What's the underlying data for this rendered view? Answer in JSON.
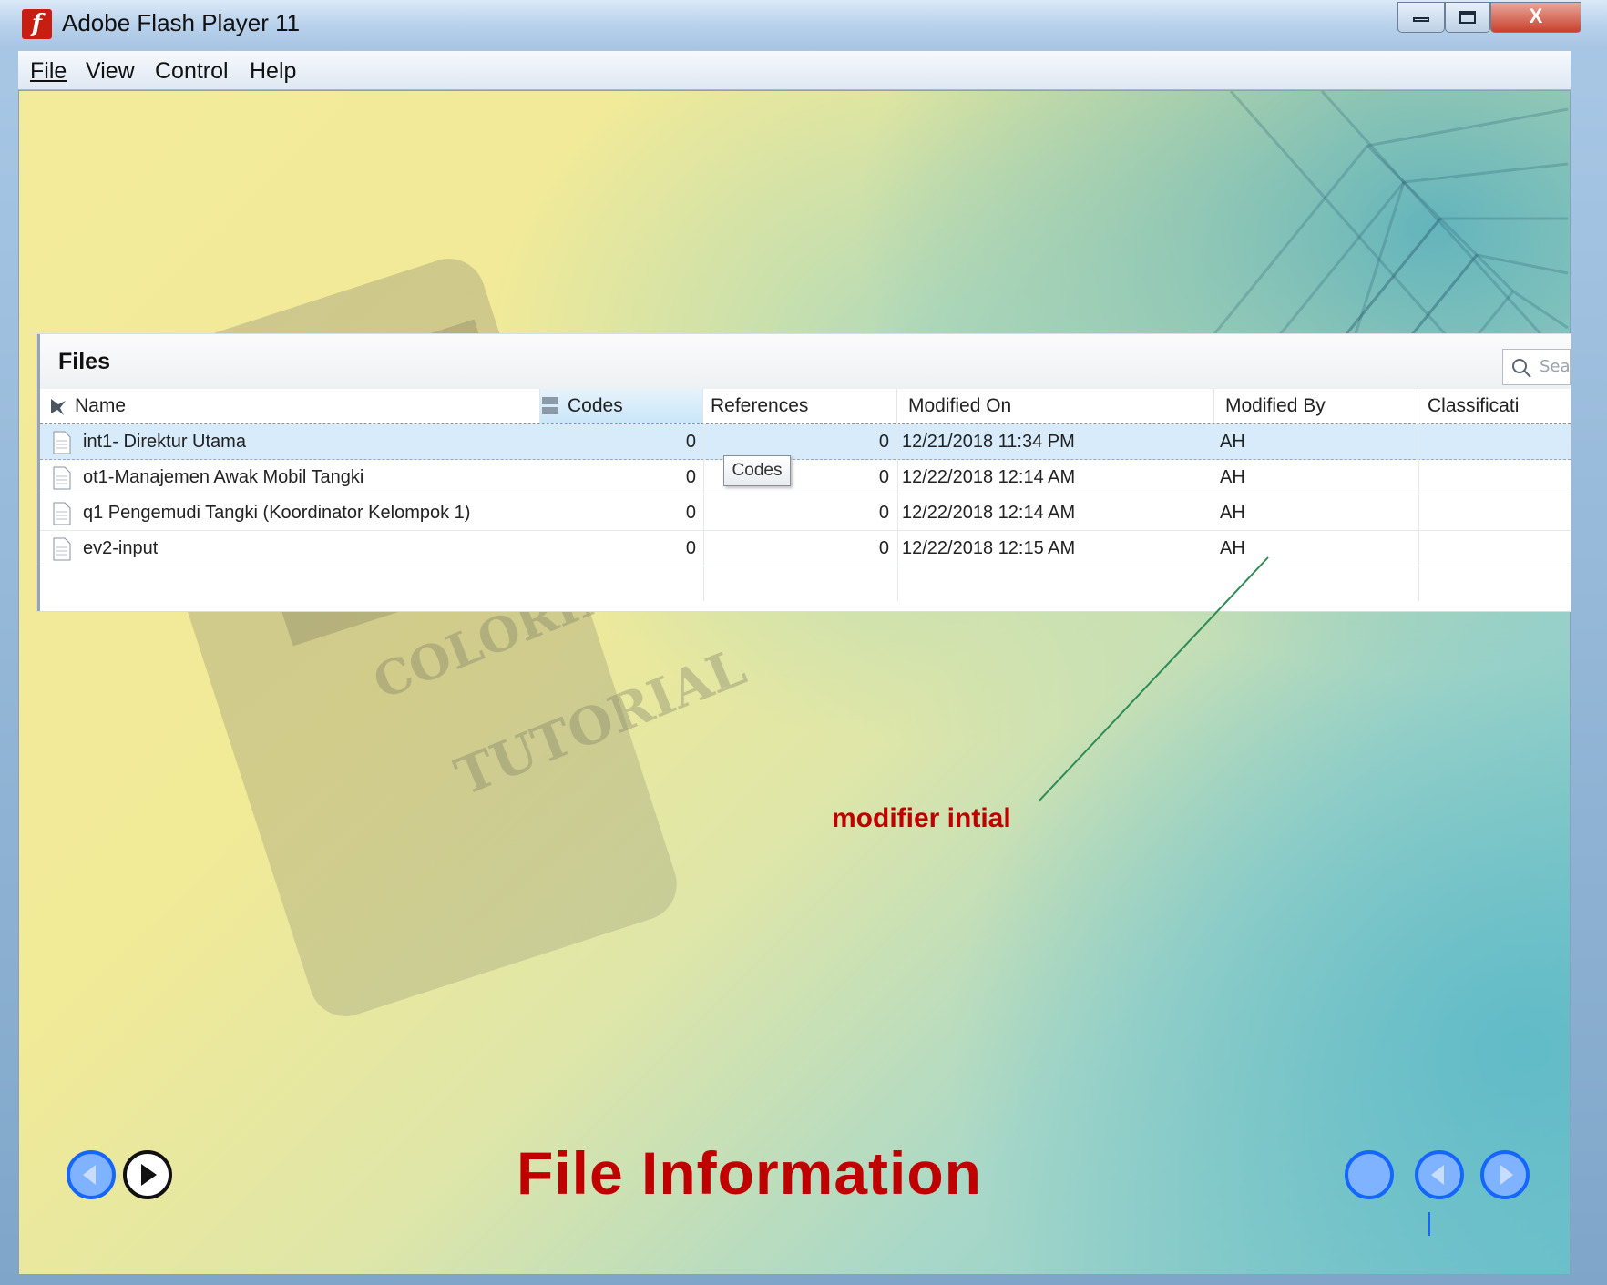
{
  "window": {
    "title": "Adobe Flash Player 11",
    "close_glyph": "X"
  },
  "menu": {
    "items": [
      "File",
      "View",
      "Control",
      "Help"
    ]
  },
  "panel": {
    "title": "Files",
    "search_placeholder": "Sea",
    "columns": [
      "Name",
      "Codes",
      "References",
      "Modified On",
      "Modified By",
      "Classificati"
    ],
    "rows": [
      {
        "name": "int1- Direktur Utama",
        "codes": "0",
        "references": "0",
        "modified_on": "12/21/2018 11:34 PM",
        "modified_by": "AH",
        "classification": ""
      },
      {
        "name": "ot1-Manajemen Awak Mobil Tangki",
        "codes": "0",
        "references": "0",
        "modified_on": "12/22/2018 12:14 AM",
        "modified_by": "AH",
        "classification": ""
      },
      {
        "name": "q1 Pengemudi Tangki (Koordinator Kelompok 1)",
        "codes": "0",
        "references": "0",
        "modified_on": "12/22/2018 12:14 AM",
        "modified_by": "AH",
        "classification": ""
      },
      {
        "name": "ev2-input",
        "codes": "0",
        "references": "0",
        "modified_on": "12/22/2018 12:15 AM",
        "modified_by": "AH",
        "classification": ""
      }
    ],
    "tooltip": "Codes"
  },
  "annotation": {
    "label": "modifier intial",
    "color": "#c00000",
    "line_color": "#2e8b57"
  },
  "slide": {
    "title": "File Information",
    "title_color": "#c00000",
    "decor_text": [
      "COLORING",
      "TUTORIAL"
    ]
  },
  "nav": {
    "left_buttons": [
      "back-icon",
      "play-icon"
    ],
    "right_buttons": [
      "home-icon",
      "previous-icon",
      "next-icon"
    ],
    "accent": "#1565ff"
  }
}
